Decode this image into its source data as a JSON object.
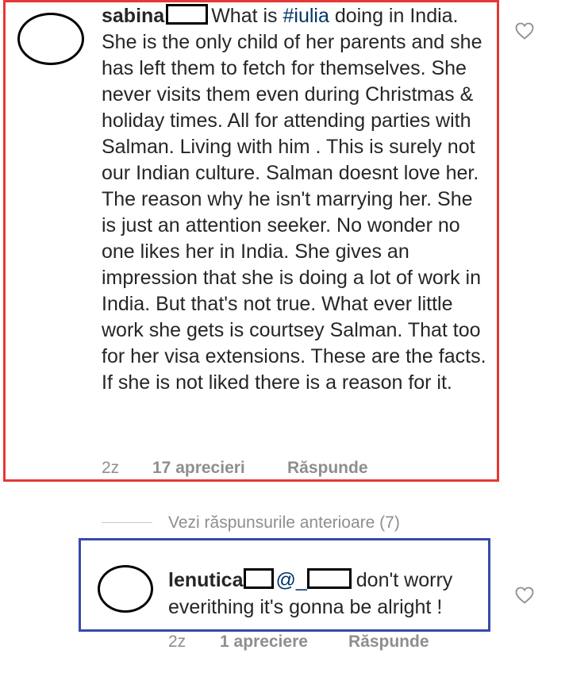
{
  "comment": {
    "username": "sabina",
    "text_before_hashtag": "What is ",
    "hashtag": "#iulia",
    "text_after_hashtag": " doing in India. She is the only child of her parents and she has left them to fetch for themselves.  She never visits them even during Christmas & holiday times. All for attending parties with Salman. Living with him . This is surely not our Indian culture. Salman doesnt love her. The reason why he isn't marrying her. She is just an attention seeker.  No wonder no one likes her in India.  She gives an impression that she is doing a lot of work in India. But that's not true. What ever little work she gets is courtsey Salman. That too for her visa extensions. These are the facts. If she is not liked there is a reason for it.",
    "time": "2z",
    "likes": "17 aprecieri",
    "reply_label": "Răspunde",
    "like_icon": "heart-outline-icon"
  },
  "view_previous_replies": "Vezi răspunsurile anterioare (7)",
  "reply": {
    "username": "lenutica",
    "mention": "@_",
    "text": "don't worry everithing it's gonna be alright !",
    "time": "2z",
    "likes": "1 apreciere",
    "reply_label": "Răspunde",
    "like_icon": "heart-outline-icon"
  },
  "colors": {
    "highlight_red": "#e53935",
    "highlight_blue": "#3949ab",
    "link": "#003569",
    "meta_gray": "#8e8e8e"
  }
}
